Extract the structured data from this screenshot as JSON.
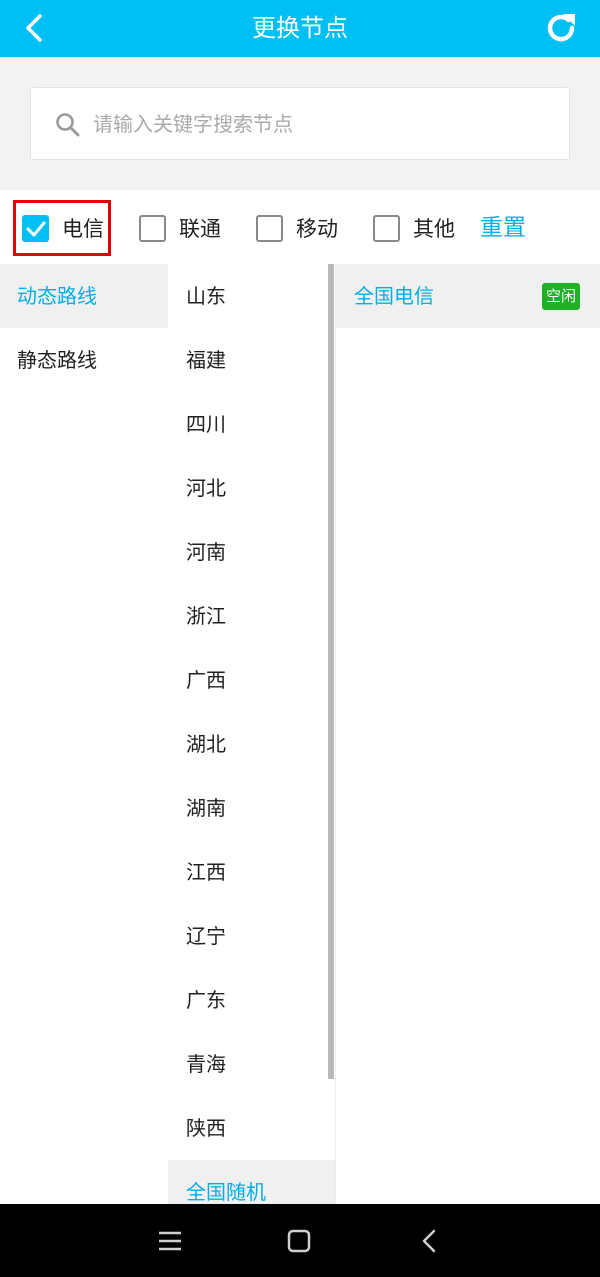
{
  "header": {
    "title": "更换节点",
    "back_icon": "chevron-left-icon",
    "refresh_icon": "refresh-icon"
  },
  "search": {
    "placeholder": "请输入关键字搜索节点",
    "value": ""
  },
  "filters": {
    "options": [
      {
        "label": "电信",
        "checked": true
      },
      {
        "label": "联通",
        "checked": false
      },
      {
        "label": "移动",
        "checked": false
      },
      {
        "label": "其他",
        "checked": false
      }
    ],
    "reset_label": "重置"
  },
  "route_types": [
    {
      "label": "动态路线",
      "active": true
    },
    {
      "label": "静态路线",
      "active": false
    }
  ],
  "regions": [
    {
      "label": "山东"
    },
    {
      "label": "福建"
    },
    {
      "label": "四川"
    },
    {
      "label": "河北"
    },
    {
      "label": "河南"
    },
    {
      "label": "浙江"
    },
    {
      "label": "广西"
    },
    {
      "label": "湖北"
    },
    {
      "label": "湖南"
    },
    {
      "label": "江西"
    },
    {
      "label": "辽宁"
    },
    {
      "label": "广东"
    },
    {
      "label": "青海"
    },
    {
      "label": "陕西"
    },
    {
      "label": "全国随机",
      "active": true
    }
  ],
  "nodes": [
    {
      "name": "全国电信",
      "status": "空闲"
    }
  ],
  "colors": {
    "accent": "#00bff3",
    "link": "#00aee8",
    "status_idle": "#1fb026",
    "highlight_border": "#e00000"
  },
  "navbar": {
    "icons": [
      "menu-icon",
      "home-square-icon",
      "back-arrow-icon"
    ]
  }
}
